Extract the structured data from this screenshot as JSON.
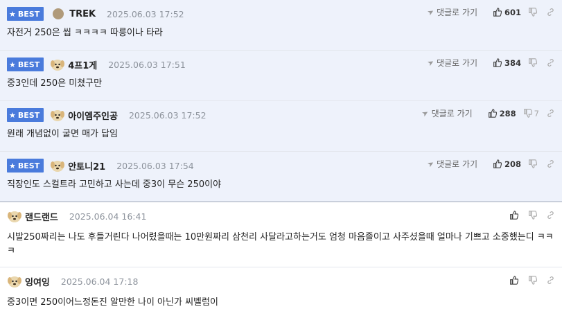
{
  "badge_label": "BEST",
  "reply_label": "댓글로 가기",
  "comments": [
    {
      "best": true,
      "nick": "TREK",
      "date": "2025.06.03 17:52",
      "text": "자전거 250은 씹 ㅋㅋㅋㅋ 따릉이나 타라",
      "up": "601",
      "down": ""
    },
    {
      "best": true,
      "nick": "4프1게",
      "date": "2025.06.03 17:51",
      "text": "중3인데 250은 미쳤구만",
      "up": "384",
      "down": ""
    },
    {
      "best": true,
      "nick": "아이엠주인공",
      "date": "2025.06.03 17:52",
      "text": "원래 개념없이 굴면 매가 답임",
      "up": "288",
      "down": "7"
    },
    {
      "best": true,
      "nick": "안토니21",
      "date": "2025.06.03 17:54",
      "text": "직장인도 스컬트라 고민하고 사는데 중3이 무슨 250이야",
      "up": "208",
      "down": ""
    },
    {
      "best": false,
      "nick": "랜드랜드",
      "date": "2025.06.04 16:41",
      "text": "시발250짜리는 나도 후들거린다 나어렸을때는 10만원짜리 삼천리 사달라고하는거도 엄청 마음졸이고 사주셨을때 얼마나 기쁘고 소중했는디 ㅋㅋㅋ",
      "up": "",
      "down": ""
    },
    {
      "best": false,
      "nick": "잉여잉",
      "date": "2025.06.04 17:18",
      "text": "중3이면 250이어느정돈진 알만한 나이 아닌가 씨벨럼이",
      "up": "",
      "down": ""
    }
  ],
  "icons": {
    "star": "star-icon",
    "reply": "arrow-icon",
    "up": "thumbs-up-icon",
    "down": "thumbs-down-icon",
    "link": "link-icon",
    "avatar": "dog-avatar-icon"
  },
  "colors": {
    "badge": "#4a7bdc",
    "best_bg": "#eef2fb"
  }
}
